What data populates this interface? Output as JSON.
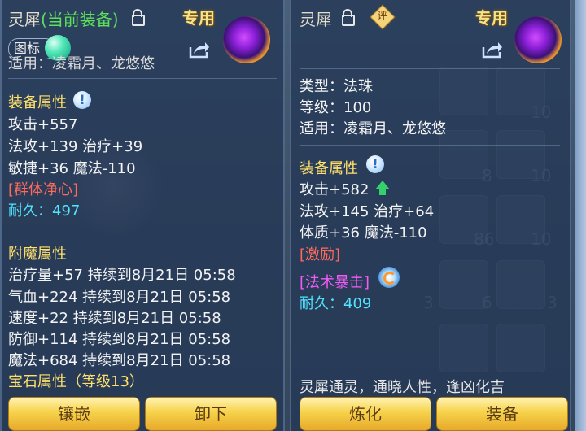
{
  "left_panel": {
    "title_prefix": "灵犀",
    "title_status": "(当前装备)",
    "exclusive": "专用",
    "icon_toggle_label": "图标",
    "use_line": "适用：凌霜月、龙悠悠",
    "equip_attr_heading": "装备属性",
    "attrs": [
      "攻击+557",
      "法攻+139 治疗+39",
      "敏捷+36 魔法-110"
    ],
    "special_skill": "[群体净心]",
    "durability": "耐久：497",
    "enchant_heading": "附魔属性",
    "enchants": [
      "治疗量+57 持续到8月21日 05:58",
      "气血+224 持续到8月21日 05:58",
      "速度+22 持续到8月21日 05:58",
      "防御+114 持续到8月21日 05:58",
      "魔法+684 持续到8月21日 05:58"
    ],
    "gem_line": "宝石属性（等级13）",
    "buttons": {
      "inlay": "镶嵌",
      "unequip": "卸下"
    }
  },
  "right_panel": {
    "title": "灵犀",
    "eval_badge": "评",
    "exclusive": "专用",
    "type_line": "类型：法珠",
    "level_line": "等级：100",
    "use_line": "适用：凌霜月、龙悠悠",
    "equip_attr_heading": "装备属性",
    "attrs": [
      "攻击+582",
      "法攻+145 治疗+64",
      "体质+36 魔法-110"
    ],
    "special_effect": "[激励]",
    "special_skill": "[法术暴击]",
    "durability": "耐久：409",
    "description": "灵犀通灵，通晓人性，逢凶化吉",
    "buttons": {
      "refine": "炼化",
      "equip": "装备"
    }
  },
  "background": {
    "numbers": [
      "10",
      "10",
      "8",
      "10",
      "86",
      "3",
      "6",
      "3"
    ]
  },
  "colors": {
    "heading_yellow": "#ffe06a",
    "skill_red": "#ff6a5a",
    "durability_cyan": "#52e3ff",
    "skill_magenta": "#f25cf5",
    "current_equip_green": "#5de05a"
  },
  "icons": [
    "lock-icon",
    "share-icon",
    "info-icon",
    "item-orb-icon",
    "upgrade-arrow-icon",
    "skill-spin-icon",
    "eval-badge-icon"
  ]
}
